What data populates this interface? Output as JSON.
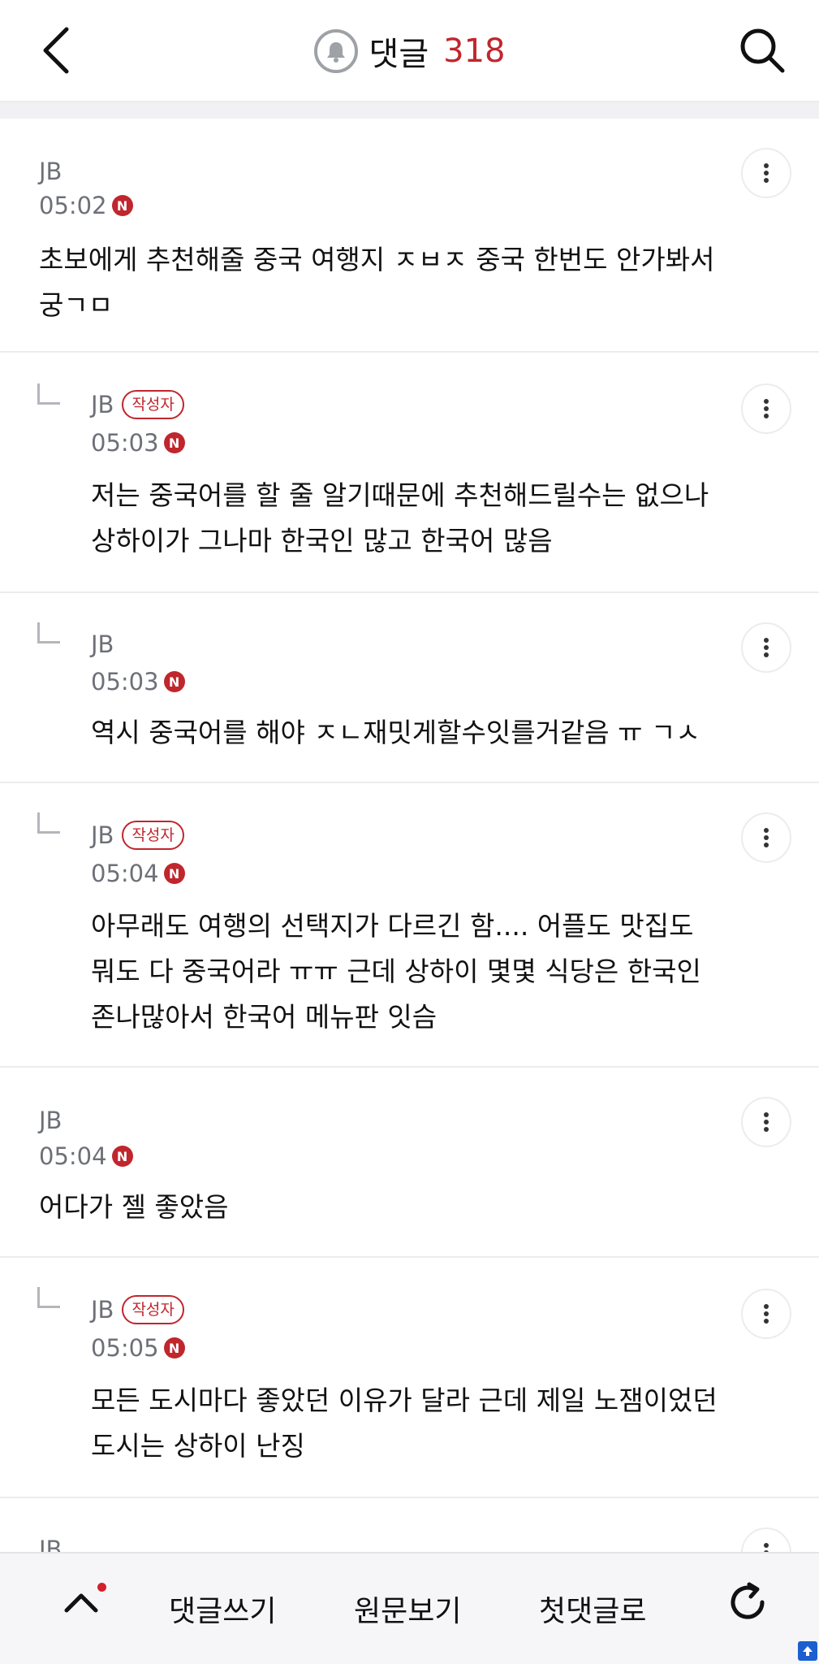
{
  "header": {
    "title": "댓글",
    "count": "318",
    "back_icon": "chevron-left-icon",
    "search_icon": "search-icon",
    "bell_icon": "bell-icon"
  },
  "comments": [
    {
      "author": "JB",
      "badge": "",
      "time": "05:02",
      "new_mark": "N",
      "body_lines": [
        "초보에게 추천해줄 중국 여행지 ㅈㅂㅈ 중국 한번도 안가봐서",
        "궁ㄱㅁ"
      ],
      "is_reply": false
    },
    {
      "author": "JB",
      "badge": "작성자",
      "time": "05:03",
      "new_mark": "N",
      "body_lines": [
        "저는 중국어를 할 줄 알기때문에 추천해드릴수는 없으나",
        "상하이가 그나마 한국인 많고 한국어 많음"
      ],
      "is_reply": true
    },
    {
      "author": "JB",
      "badge": "",
      "time": "05:03",
      "new_mark": "N",
      "body_lines": [
        "역시 중국어를 해야 ㅈㄴ재밋게할수잇를거같음 ㅠ ㄱㅅ"
      ],
      "is_reply": true
    },
    {
      "author": "JB",
      "badge": "작성자",
      "time": "05:04",
      "new_mark": "N",
      "body_lines": [
        "아무래도 여행의 선택지가 다르긴 함.... 어플도 맛집도",
        "뭐도 다 중국어라 ㅠㅠ 근데 상하이 몇몇 식당은 한국인",
        "존나많아서 한국어 메뉴판 잇슴"
      ],
      "is_reply": true
    },
    {
      "author": "JB",
      "badge": "",
      "time": "05:04",
      "new_mark": "N",
      "body_lines": [
        "어다가 젤 좋았음"
      ],
      "is_reply": false
    },
    {
      "author": "JB",
      "badge": "작성자",
      "time": "05:05",
      "new_mark": "N",
      "body_lines": [
        "모든 도시마다 좋았던 이유가 달라 근데 제일 노잼이었던",
        "도시는 상하이 난징"
      ],
      "is_reply": true
    }
  ],
  "partial_author": "JB",
  "bottom_bar": {
    "up_icon": "chevron-up-icon",
    "write_label": "댓글쓰기",
    "original_label": "원문보기",
    "first_label": "첫댓글로",
    "refresh_icon": "refresh-icon"
  },
  "colors": {
    "accent_red": "#c0262d",
    "meta_gray": "#6d7077",
    "divider": "#ececec"
  }
}
